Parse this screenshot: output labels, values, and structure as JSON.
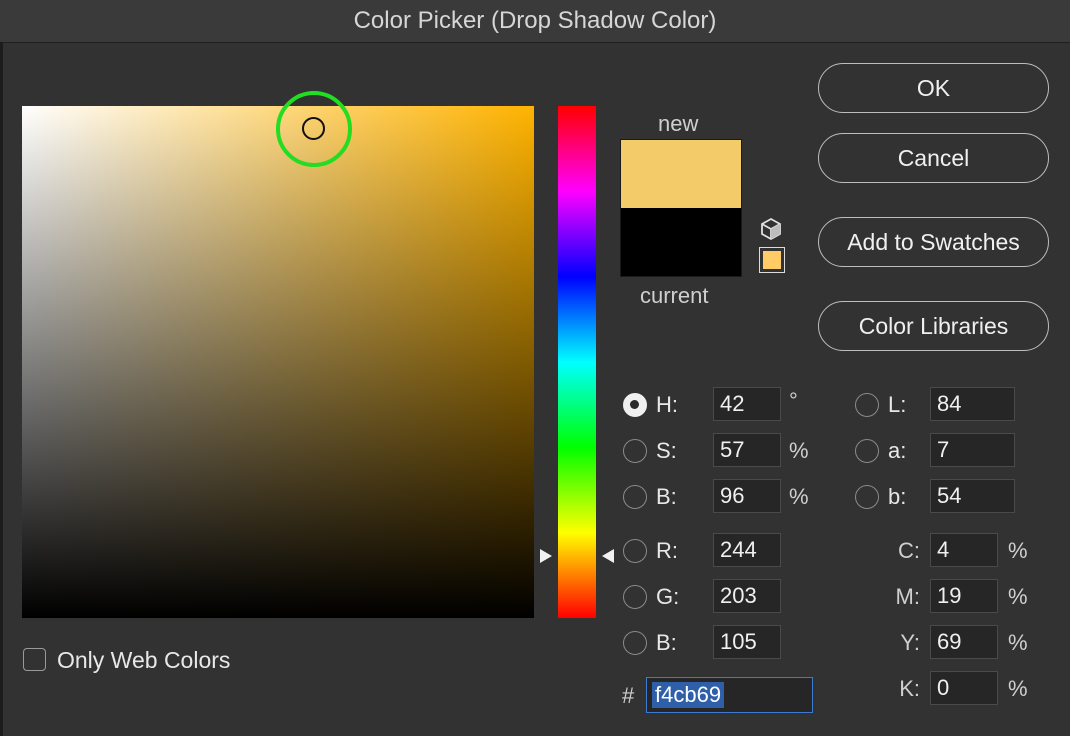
{
  "window": {
    "title": "Color Picker (Drop Shadow Color)"
  },
  "colors": {
    "new_color": "#f4cb69",
    "current_color": "#000000",
    "hue_base": "#ffb300",
    "marker_ring": "#22dd22",
    "hex_highlight": "#2f5fa8"
  },
  "picker": {
    "selected_hue_deg": 42,
    "saturation_pct": 57,
    "brightness_pct": 96
  },
  "swatch": {
    "new_label": "new",
    "current_label": "current"
  },
  "buttons": {
    "ok": "OK",
    "cancel": "Cancel",
    "add_to_swatches": "Add to Swatches",
    "color_libraries": "Color Libraries"
  },
  "hsb": [
    {
      "label": "H:",
      "value": "42",
      "unit": "°",
      "selected": true
    },
    {
      "label": "S:",
      "value": "57",
      "unit": "%",
      "selected": false
    },
    {
      "label": "B:",
      "value": "96",
      "unit": "%",
      "selected": false
    }
  ],
  "rgb": [
    {
      "label": "R:",
      "value": "244"
    },
    {
      "label": "G:",
      "value": "203"
    },
    {
      "label": "B:",
      "value": "105"
    }
  ],
  "lab": [
    {
      "label": "L:",
      "value": "84"
    },
    {
      "label": "a:",
      "value": "7"
    },
    {
      "label": "b:",
      "value": "54"
    }
  ],
  "cmyk": [
    {
      "label": "C:",
      "value": "4",
      "unit": "%"
    },
    {
      "label": "M:",
      "value": "19",
      "unit": "%"
    },
    {
      "label": "Y:",
      "value": "69",
      "unit": "%"
    },
    {
      "label": "K:",
      "value": "0",
      "unit": "%"
    }
  ],
  "hex": {
    "prefix": "#",
    "value": "f4cb69"
  },
  "options": {
    "only_web_colors": "Only Web Colors",
    "only_web_colors_checked": false
  },
  "icons": {
    "out_of_gamut": "cube-icon",
    "web_safe": "websafe-swatch-icon"
  }
}
